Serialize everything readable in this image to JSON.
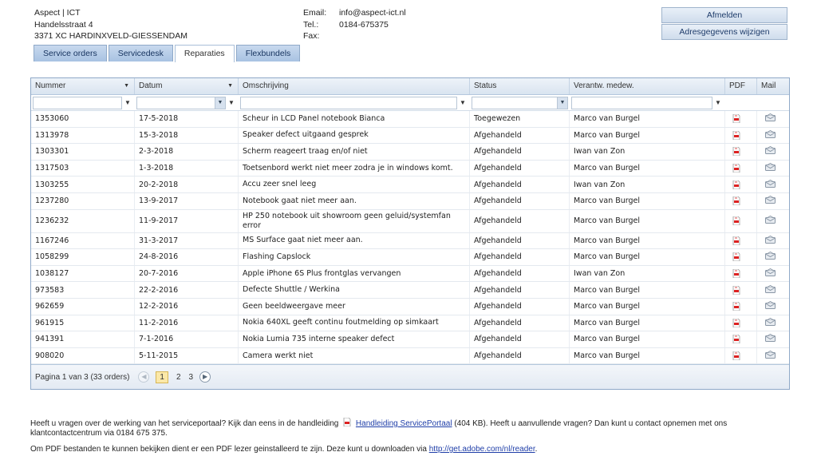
{
  "company": {
    "name": "Aspect | ICT",
    "street": "Handelsstraat 4",
    "city": "3371 XC  HARDINXVELD-GIESSENDAM"
  },
  "contact": {
    "email_label": "Email:",
    "email": "info@aspect-ict.nl",
    "tel_label": "Tel.:",
    "tel": "0184-675375",
    "fax_label": "Fax:",
    "fax": ""
  },
  "buttons": {
    "logout": "Afmelden",
    "edit_address": "Adresgegevens wijzigen"
  },
  "tabs": [
    {
      "label": "Service orders",
      "active": false
    },
    {
      "label": "Servicedesk",
      "active": false
    },
    {
      "label": "Reparaties",
      "active": true
    },
    {
      "label": "Flexbundels",
      "active": false
    }
  ],
  "grid": {
    "columns": [
      "Nummer",
      "Datum",
      "Omschrijving",
      "Status",
      "Verantw. medew.",
      "PDF",
      "Mail"
    ],
    "rows": [
      [
        "1353060",
        "17-5-2018",
        "Scheur in LCD Panel notebook Bianca",
        "Toegewezen",
        "Marco van Burgel"
      ],
      [
        "1313978",
        "15-3-2018",
        "Speaker defect uitgaand gesprek",
        "Afgehandeld",
        "Marco van Burgel"
      ],
      [
        "1303301",
        "2-3-2018",
        "Scherm reageert traag en/of niet",
        "Afgehandeld",
        "Iwan van Zon"
      ],
      [
        "1317503",
        "1-3-2018",
        "Toetsenbord werkt niet meer zodra je in windows komt.",
        "Afgehandeld",
        "Marco van Burgel"
      ],
      [
        "1303255",
        "20-2-2018",
        "Accu zeer snel leeg",
        "Afgehandeld",
        "Iwan van Zon"
      ],
      [
        "1237280",
        "13-9-2017",
        "Notebook gaat niet meer aan.",
        "Afgehandeld",
        "Marco van Burgel"
      ],
      [
        "1236232",
        "11-9-2017",
        "HP 250 notebook uit showroom geen geluid/systemfan error",
        "Afgehandeld",
        "Marco van Burgel"
      ],
      [
        "1167246",
        "31-3-2017",
        "MS Surface gaat niet meer aan.",
        "Afgehandeld",
        "Marco van Burgel"
      ],
      [
        "1058299",
        "24-8-2016",
        "Flashing Capslock",
        "Afgehandeld",
        "Marco van Burgel"
      ],
      [
        "1038127",
        "20-7-2016",
        "Apple iPhone 6S Plus frontglas vervangen",
        "Afgehandeld",
        "Iwan van Zon"
      ],
      [
        "973583",
        "22-2-2016",
        "Defecte Shuttle / Werkina",
        "Afgehandeld",
        "Marco van Burgel"
      ],
      [
        "962659",
        "12-2-2016",
        "Geen beeldweergave meer",
        "Afgehandeld",
        "Marco van Burgel"
      ],
      [
        "961915",
        "11-2-2016",
        "Nokia 640XL geeft continu foutmelding op simkaart",
        "Afgehandeld",
        "Marco van Burgel"
      ],
      [
        "941391",
        "7-1-2016",
        "Nokia Lumia 735 interne speaker defect",
        "Afgehandeld",
        "Marco van Burgel"
      ],
      [
        "908020",
        "5-11-2015",
        "Camera werkt niet",
        "Afgehandeld",
        "Marco van Burgel"
      ]
    ],
    "pager": {
      "info": "Pagina 1 van 3 (33 orders)",
      "pages": [
        "1",
        "2",
        "3"
      ],
      "current": "1"
    }
  },
  "icons": {
    "pdf": "pdf-icon",
    "mail": "envelope-icon",
    "filter": "filter-icon",
    "sort": "sort-down-icon",
    "prev": "prev-page-icon",
    "next": "next-page-icon"
  },
  "footer": {
    "p1_before": "Heeft u vragen over de werking van het serviceportaal? Kijk dan eens in de handleiding",
    "manual_link": "Handleiding ServicePortaal",
    "p1_after": "(404 KB). Heeft u aanvullende vragen? Dan kunt u contact opnemen met ons klantcontactcentrum via 0184 675 375.",
    "p2_before": "Om PDF bestanden te kunnen bekijken dient er een PDF lezer geinstalleerd te zijn. Deze kunt u downloaden via",
    "adobe_link": "http://get.adobe.com/nl/reader",
    "p2_after": "."
  },
  "colors": {
    "accent": "#8fa9c8",
    "tab": "#a8c2e2",
    "link": "#1f3ea8",
    "pdf_red": "#d22"
  }
}
